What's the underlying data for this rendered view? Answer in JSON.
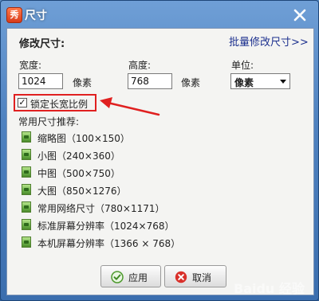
{
  "window": {
    "app_icon_text": "秀",
    "title": "尺寸"
  },
  "section": {
    "heading": "修改尺寸:",
    "batch_link": "批量修改尺寸>>"
  },
  "width": {
    "label": "宽度:",
    "value": "1024",
    "unit": "像素"
  },
  "height": {
    "label": "高度:",
    "value": "768",
    "unit": "像素"
  },
  "unit_select": {
    "label": "单位:",
    "value": "像素"
  },
  "lock_ratio": {
    "label": "锁定长宽比例",
    "checked": true
  },
  "recommend": {
    "label": "常用尺寸推荐:",
    "items": [
      "缩略图（100×150）",
      "小图（240×360）",
      "中图（500×750）",
      "大图（850×1276）",
      "常用网络尺寸（780×1171）",
      "标准屏幕分辨率（1024×768）",
      "本机屏幕分辨率（1366 × 768）"
    ]
  },
  "buttons": {
    "ok_label": "应用",
    "cancel_label": "取消"
  },
  "watermark": "Baidu 经验",
  "colors": {
    "highlight_red": "#e02020",
    "link_blue": "#1b2f8e",
    "title_blue": "#4f82c0"
  }
}
